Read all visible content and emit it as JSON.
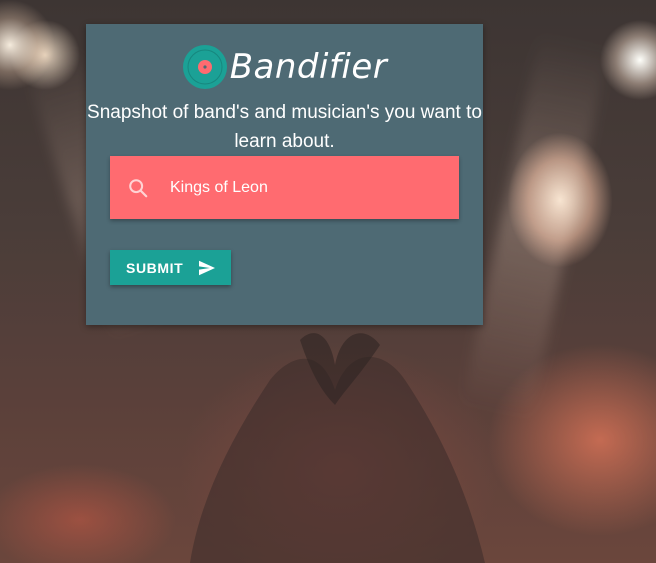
{
  "app": {
    "brand_name": "Bandifier",
    "tagline": "Snapshot of band's and musician's you want to learn about."
  },
  "search": {
    "value": "Kings of Leon",
    "icon": "search-icon"
  },
  "submit": {
    "label": "SUBMIT",
    "icon": "send-icon"
  },
  "colors": {
    "card": "#4e6a74",
    "search_bg": "#ff6b70",
    "submit_bg": "#1ba196",
    "logo_outer": "#1ba196",
    "logo_inner": "#ff6b70"
  },
  "background": "concert crowd photo with heart-shaped hands"
}
